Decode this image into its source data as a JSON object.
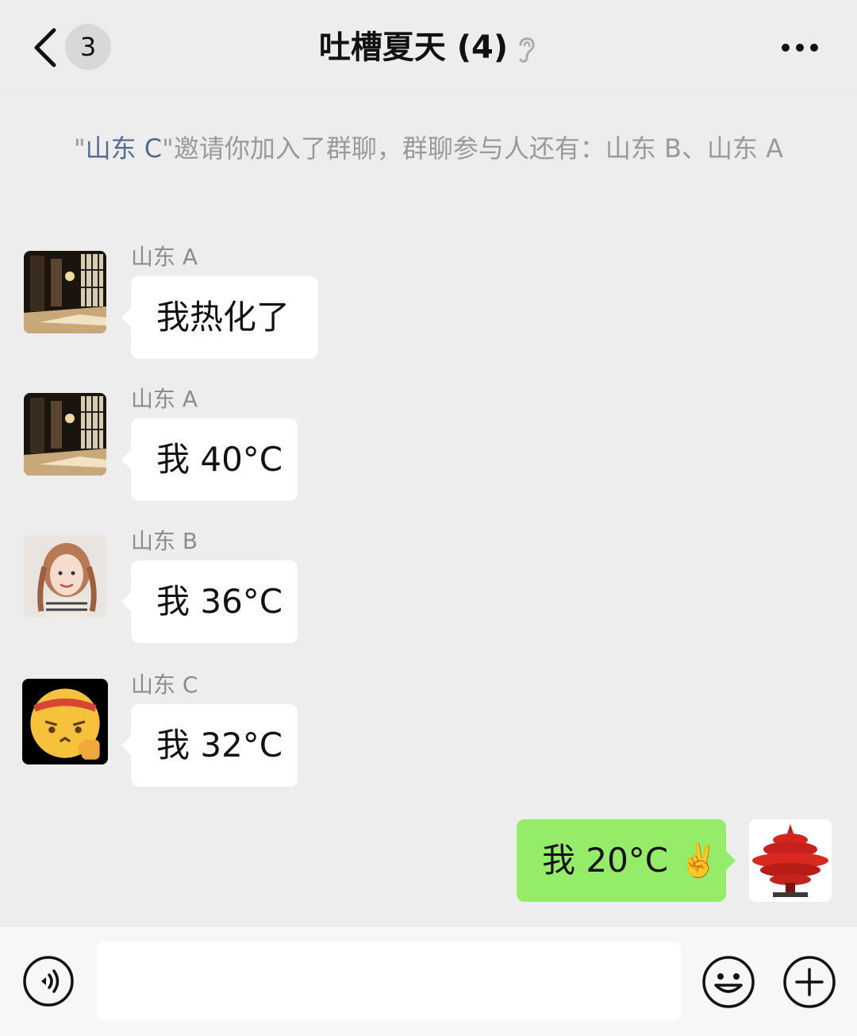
{
  "header": {
    "unread_count": "3",
    "title": "吐槽夏天 (4)"
  },
  "notice": {
    "quote_open": "\"",
    "inviter": "山东 C",
    "text": "\"邀请你加入了群聊，群聊参与人还有：山东 B、山东 A"
  },
  "messages": [
    {
      "sender": "山东 A",
      "text": "我热化了"
    },
    {
      "sender": "山东 A",
      "text": "我 40°C"
    },
    {
      "sender": "山东 B",
      "text": "我 36°C"
    },
    {
      "sender": "山东 C",
      "text": "我 32°C"
    }
  ],
  "my_message": {
    "text": "我 20°C",
    "emoji": "✌️"
  },
  "input": {
    "value": ""
  },
  "icons": {
    "back": "chevron-left-icon",
    "ear": "ear-icon",
    "more": "more-dots-icon",
    "voice": "voice-icon",
    "emoji": "smiley-icon",
    "plus": "plus-icon"
  },
  "colors": {
    "background": "#ededed",
    "my_bubble": "#95ec69",
    "other_bubble": "#ffffff",
    "link": "#586b95"
  }
}
